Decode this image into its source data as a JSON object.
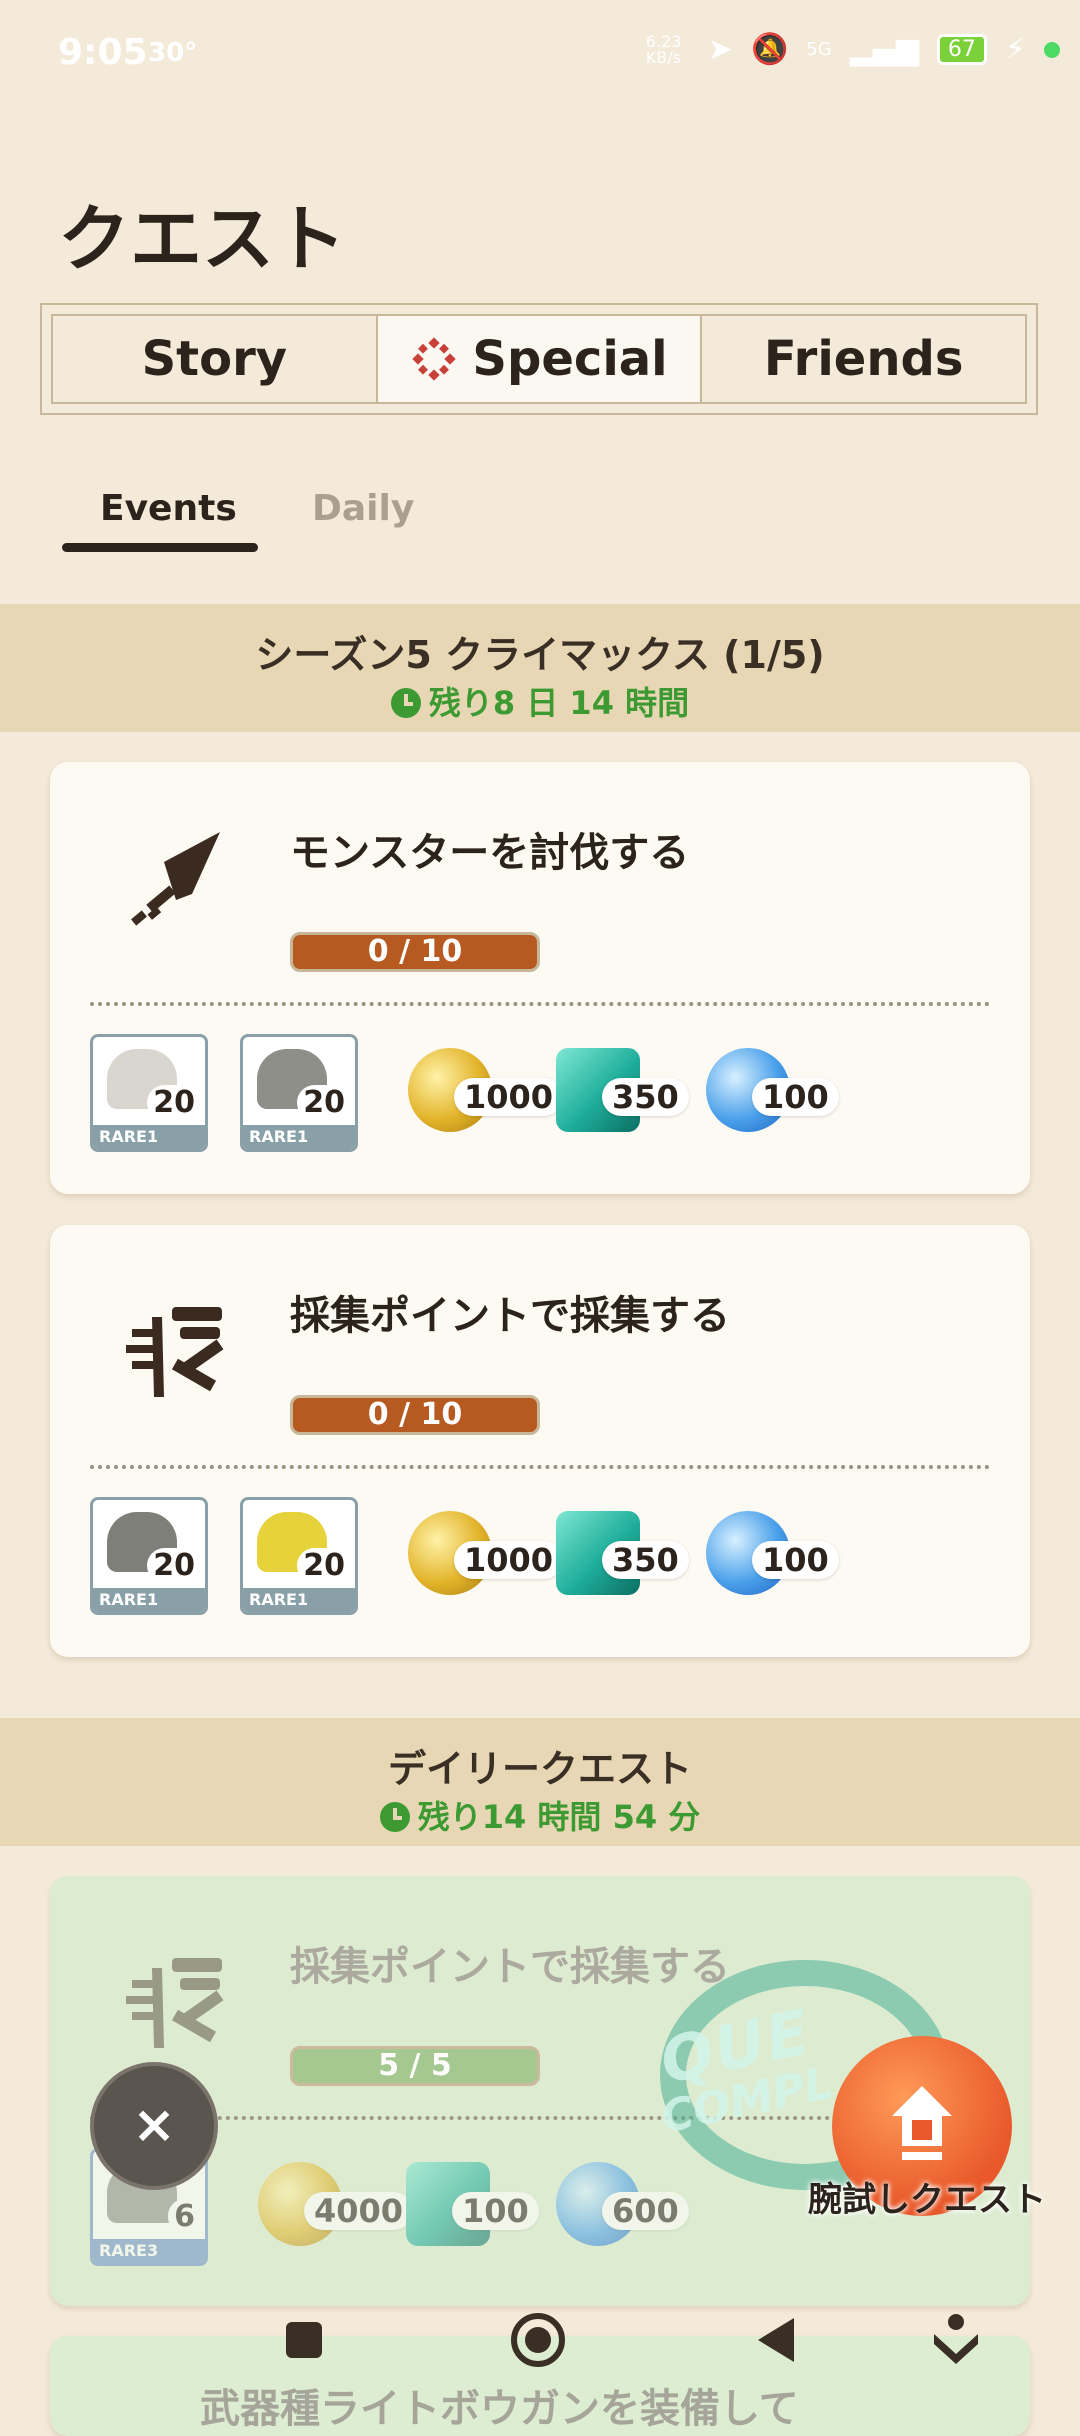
{
  "status_bar": {
    "time": "9:05",
    "temperature": "30°",
    "net_speed": "6.23 KB/s",
    "signal": "5G",
    "battery": "67"
  },
  "page_title": "クエスト",
  "tabs": [
    {
      "label": "Story",
      "active": false
    },
    {
      "label": "Special",
      "active": true,
      "icon": "special-emblem-icon"
    },
    {
      "label": "Friends",
      "active": false
    }
  ],
  "subtabs": [
    {
      "label": "Events",
      "active": true
    },
    {
      "label": "Daily",
      "active": false
    }
  ],
  "sections": {
    "season": {
      "title": "シーズン5 クライマックス (1/5)",
      "time_left": "残り8 日 14 時間"
    },
    "daily": {
      "title": "デイリークエスト",
      "time_left": "残り14 時間 54 分"
    }
  },
  "quests": [
    {
      "title": "モンスターを討伐する",
      "icon": "sword-icon",
      "progress": "0 / 10",
      "progress_fraction": 0,
      "rewards": {
        "items": [
          {
            "icon": "bone-material-icon",
            "count": "20",
            "rarity": "RARE1"
          },
          {
            "icon": "monster-material-icon",
            "count": "20",
            "rarity": "RARE1"
          }
        ],
        "zenny": "1000",
        "gem": "350",
        "orb": "100"
      }
    },
    {
      "title": "採集ポイントで採集する",
      "icon": "gather-tools-icon",
      "progress": "0 / 10",
      "progress_fraction": 0,
      "rewards": {
        "items": [
          {
            "icon": "ore-material-icon",
            "count": "20",
            "rarity": "RARE1"
          },
          {
            "icon": "yellow-material-icon",
            "count": "20",
            "rarity": "RARE1"
          }
        ],
        "zenny": "1000",
        "gem": "350",
        "orb": "100"
      }
    },
    {
      "title": "採集ポイントで採集する",
      "icon": "gather-tools-icon",
      "progress": "5 / 5",
      "progress_fraction": 1,
      "completed": true,
      "rewards": {
        "items": [
          {
            "icon": "ore-material-icon",
            "count": "6",
            "rarity": "RARE3"
          }
        ],
        "zenny": "4000",
        "gem": "100",
        "orb": "600"
      }
    }
  ],
  "next_quest_partial": "武器種ライトボウガンを装備して",
  "overlay": {
    "stamp_line1": "QUE",
    "stamp_line2": "COMPL",
    "fab_label": "腕試しクエスト",
    "close_symbol": "×"
  }
}
